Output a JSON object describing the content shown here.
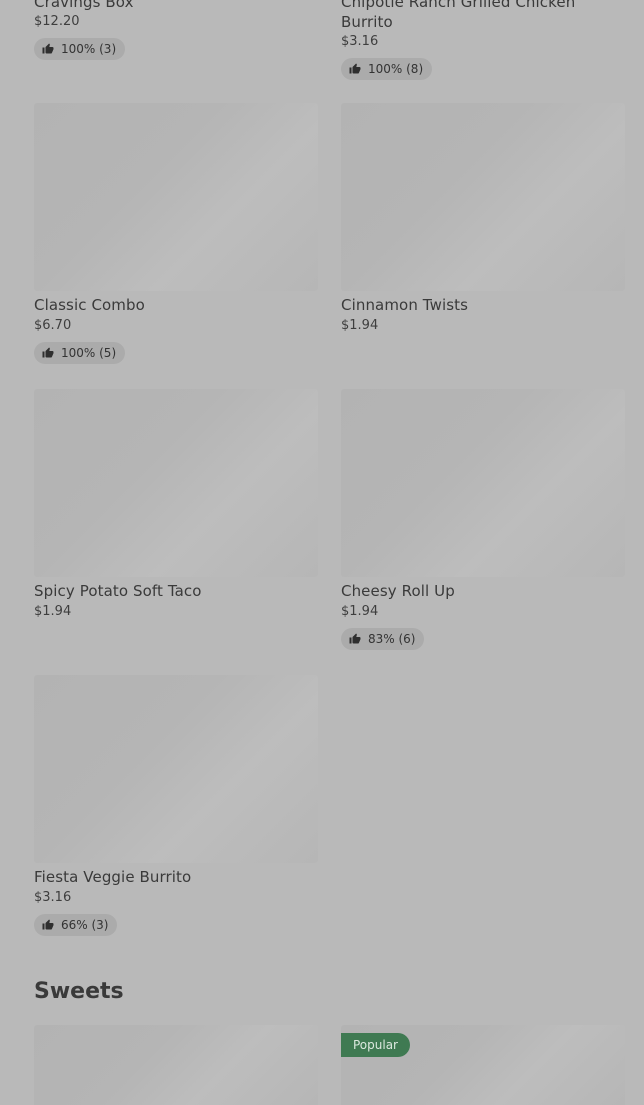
{
  "items": {
    "cravings_box": {
      "name": "Cravings Box",
      "price": "$12.20",
      "rating": "100% (3)"
    },
    "chipotle_burrito": {
      "name": "Chipotle Ranch Grilled Chicken Burrito",
      "price": "$3.16",
      "rating": "100% (8)"
    },
    "classic_combo": {
      "name": "Classic Combo",
      "price": "$6.70",
      "rating": "100% (5)"
    },
    "cinnamon_twists": {
      "name": "Cinnamon Twists",
      "price": "$1.94"
    },
    "spicy_potato_taco": {
      "name": "Spicy Potato Soft Taco",
      "price": "$1.94"
    },
    "cheesy_roll_up": {
      "name": "Cheesy Roll Up",
      "price": "$1.94",
      "rating": "83% (6)"
    },
    "fiesta_veggie_burrito": {
      "name": "Fiesta Veggie Burrito",
      "price": "$3.16",
      "rating": "66% (3)"
    }
  },
  "sections": {
    "sweets": {
      "title": "Sweets",
      "popular_badge": "Popular"
    }
  },
  "icons": {
    "rating": "thumbs-up-icon"
  },
  "colors": {
    "overlay_bg": "#b9b9b9",
    "popular_badge": "#3f7a52"
  }
}
